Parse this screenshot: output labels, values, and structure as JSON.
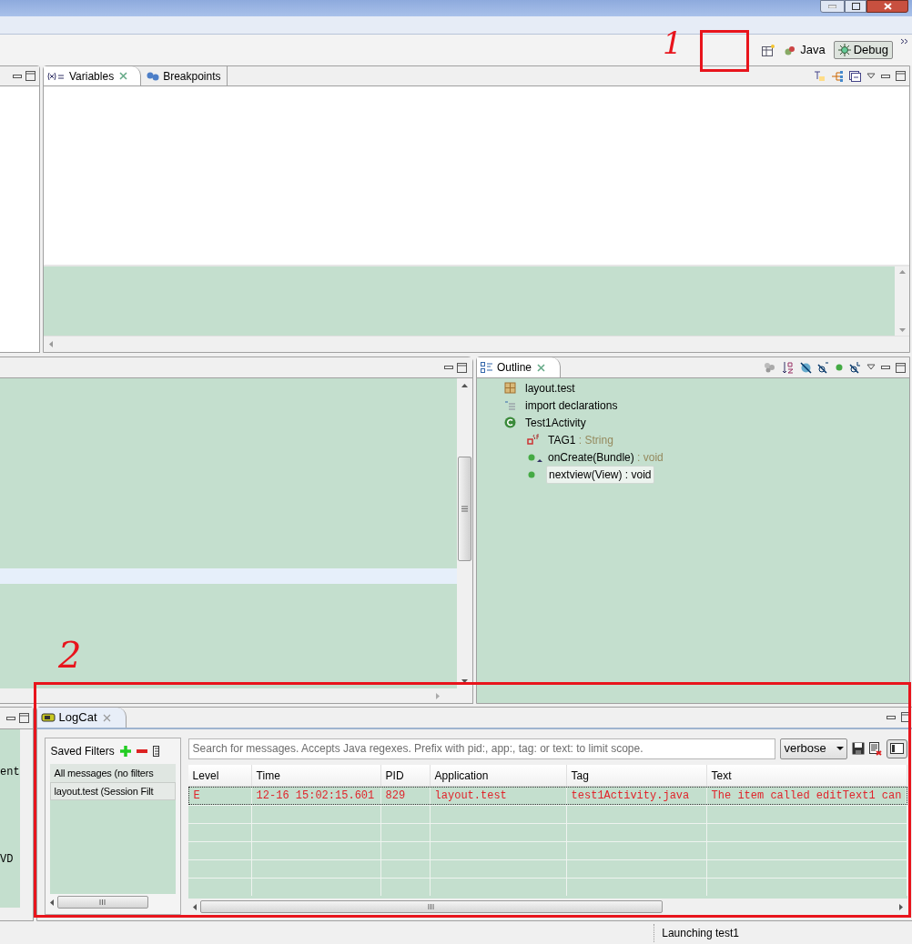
{
  "perspectives": [
    {
      "label": "Java",
      "selected": false
    },
    {
      "label": "Debug",
      "selected": true
    }
  ],
  "variables_view": {
    "tabs": [
      {
        "label": "Variables",
        "selected": true,
        "kind": "variables"
      },
      {
        "label": "Breakpoints",
        "selected": false,
        "kind": "breakpoints"
      }
    ]
  },
  "outline": {
    "title": "Outline",
    "items": [
      {
        "label": "layout.test",
        "kind": "package",
        "selected": false
      },
      {
        "label": "import declarations",
        "kind": "imports",
        "selected": false
      },
      {
        "label": "Test1Activity",
        "kind": "class",
        "selected": false,
        "children": [
          {
            "label": "TAG1",
            "type": " : String",
            "kind": "field",
            "selected": false
          },
          {
            "label": "onCreate(Bundle)",
            "type": " : void",
            "kind": "override",
            "selected": false
          },
          {
            "label": "nextview(View)",
            "type": " : void",
            "kind": "method",
            "selected": true
          }
        ]
      }
    ]
  },
  "console_fragments": [
    "ent",
    "VD"
  ],
  "logcat": {
    "title": "LogCat",
    "saved_filters": {
      "label": "Saved Filters",
      "items": [
        {
          "label": "All messages (no filters",
          "selected": false
        },
        {
          "label": "layout.test (Session Filt",
          "selected": true
        }
      ]
    },
    "search": {
      "placeholder": "Search for messages. Accepts Java regexes. Prefix with pid:, app:, tag: or text: to limit scope."
    },
    "log_level": "verbose",
    "columns": [
      "Level",
      "Time",
      "PID",
      "Application",
      "Tag",
      "Text"
    ],
    "rows": [
      {
        "selected": true,
        "cells": [
          "E",
          "12-16 15:02:15.601",
          "829",
          "layout.test",
          "test1Activity.java",
          "The item called editText1 can"
        ]
      }
    ]
  },
  "annotations": [
    {
      "label": "1"
    },
    {
      "label": "2"
    }
  ],
  "status_bar": {
    "message": "Launching test1"
  }
}
